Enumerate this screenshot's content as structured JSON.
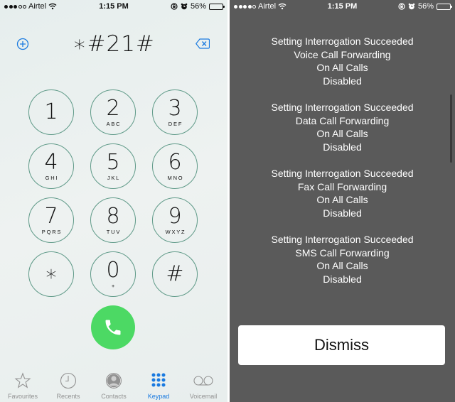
{
  "left_screen": {
    "status_bar": {
      "signal_bars_filled": 3,
      "signal_bars_total": 5,
      "carrier": "Airtel",
      "time": "1:15 PM",
      "battery_percent": "56%",
      "battery_level": 0.56,
      "icons": [
        "signal-dots-icon",
        "wifi-icon",
        "rotation-lock-icon",
        "alarm-icon",
        "battery-icon"
      ]
    },
    "dialer": {
      "entered_number": "∗#21#",
      "add_contact_icon": "plus-circle-icon",
      "backspace_icon": "backspace-icon"
    },
    "keypad": [
      {
        "digit": "1",
        "letters": ""
      },
      {
        "digit": "2",
        "letters": "ABC"
      },
      {
        "digit": "3",
        "letters": "DEF"
      },
      {
        "digit": "4",
        "letters": "GHI"
      },
      {
        "digit": "5",
        "letters": "JKL"
      },
      {
        "digit": "6",
        "letters": "MNO"
      },
      {
        "digit": "7",
        "letters": "PQRS"
      },
      {
        "digit": "8",
        "letters": "TUV"
      },
      {
        "digit": "9",
        "letters": "WXYZ"
      },
      {
        "digit": "∗",
        "letters": ""
      },
      {
        "digit": "0",
        "letters": "+"
      },
      {
        "digit": "#",
        "letters": ""
      }
    ],
    "call_button_icon": "phone-icon",
    "tabs": [
      {
        "label": "Favourites",
        "icon": "star-icon",
        "active": false
      },
      {
        "label": "Recents",
        "icon": "clock-icon",
        "active": false
      },
      {
        "label": "Contacts",
        "icon": "contact-icon",
        "active": false
      },
      {
        "label": "Keypad",
        "icon": "keypad-icon",
        "active": true
      },
      {
        "label": "Voicemail",
        "icon": "voicemail-icon",
        "active": false
      }
    ],
    "colors": {
      "accent": "#1a7ae0",
      "call_green": "#4cd964",
      "key_ring": "#5f9a88"
    }
  },
  "right_screen": {
    "status_bar": {
      "signal_bars_filled": 4,
      "signal_bars_total": 5,
      "carrier": "Airtel",
      "time": "1:15 PM",
      "battery_percent": "56%",
      "battery_level": 0.56
    },
    "messages": [
      {
        "line1": "Setting Interrogation Succeeded",
        "line2": "Voice Call Forwarding",
        "line3": "On All Calls",
        "line4": "Disabled"
      },
      {
        "line1": "Setting Interrogation Succeeded",
        "line2": "Data Call Forwarding",
        "line3": "On All Calls",
        "line4": "Disabled"
      },
      {
        "line1": "Setting Interrogation Succeeded",
        "line2": "Fax Call Forwarding",
        "line3": "On All Calls",
        "line4": "Disabled"
      },
      {
        "line1": "Setting Interrogation Succeeded",
        "line2": "SMS Call Forwarding",
        "line3": "On All Calls",
        "line4": "Disabled"
      }
    ],
    "dismiss_label": "Dismiss",
    "colors": {
      "background": "#5a5a5a",
      "text": "#ffffff"
    }
  }
}
